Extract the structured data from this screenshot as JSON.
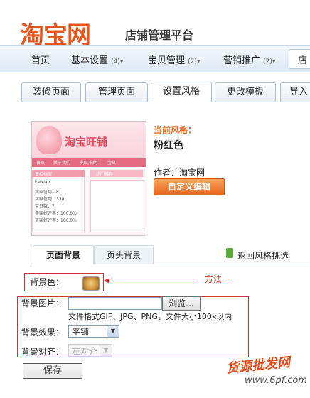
{
  "header": {
    "logo": "淘宝网",
    "subtitle": "店铺管理平台"
  },
  "nav": {
    "items": [
      {
        "label": "首页",
        "badge": ""
      },
      {
        "label": "基本设置",
        "badge": "(4)▾"
      },
      {
        "label": "宝贝管理",
        "badge": "(2)▾"
      },
      {
        "label": "营销推广",
        "badge": "(2)▾"
      }
    ],
    "more": "店"
  },
  "tabs": [
    "装修页面",
    "管理页面",
    "设置风格",
    "更改模板",
    "导入"
  ],
  "theme": {
    "current_label": "当前风格：",
    "name": "粉红色",
    "author": "作者：淘宝网",
    "customize_btn": "自定义编辑",
    "preview": {
      "logo": "淘宝旺铺",
      "menu": [
        "首页",
        "关于我们",
        "购买说明",
        "宝贝"
      ],
      "sidebar_title": "掌柜档案",
      "hot": "热门推荐",
      "lines": [
        "kaixiao",
        "卖家信用：8",
        "买家信用：338",
        "宝贝数：7",
        "卖家好评率：100.0%",
        "买家好评率：100.0%"
      ]
    }
  },
  "subtabs": [
    "页面背景",
    "页头背景"
  ],
  "back_link": "返回风格挑选",
  "form": {
    "bg_color_label": "背景色：",
    "bg_image_label": "背景图片：",
    "browse_btn": "浏览...",
    "hint": "文件格式GIF、JPG、PNG，文件大小100k以内",
    "effect_label": "背景效果：",
    "effect_value": "平铺",
    "align_label": "背景对齐：",
    "align_value": "左对齐",
    "save_btn": "保存"
  },
  "annotation": {
    "method": "方法一"
  },
  "watermark": {
    "text": "货源批发网",
    "site": "www.6pf.com"
  }
}
